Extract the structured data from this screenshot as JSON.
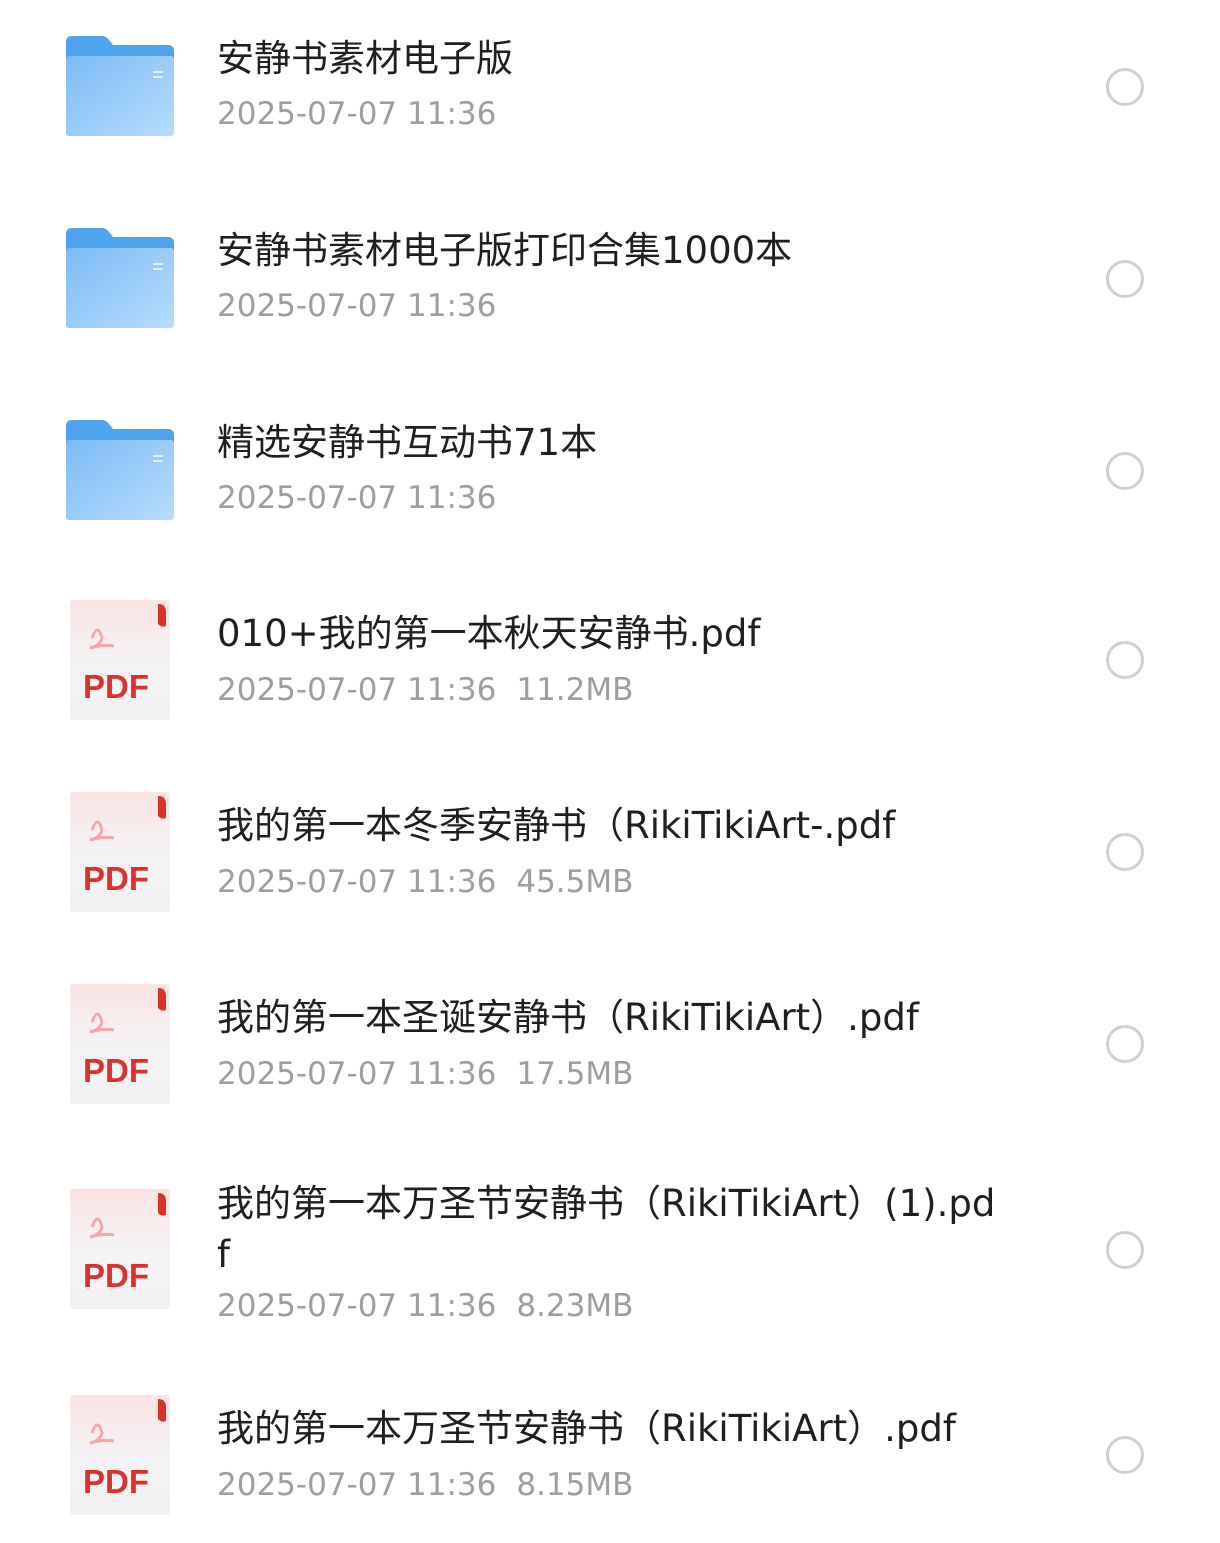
{
  "files": [
    {
      "type": "folder",
      "icon": "folder-icon",
      "name": "安静书素材电子版",
      "date": "2025-07-07 11:36",
      "size": ""
    },
    {
      "type": "folder",
      "icon": "folder-icon",
      "name": "安静书素材电子版打印合集1000本",
      "date": "2025-07-07 11:36",
      "size": ""
    },
    {
      "type": "folder",
      "icon": "folder-icon",
      "name": "精选安静书互动书71本",
      "date": "2025-07-07 11:36",
      "size": ""
    },
    {
      "type": "pdf",
      "icon": "pdf-file-icon",
      "icon_label": "PDF",
      "name": "010+我的第一本秋天安静书.pdf",
      "date": "2025-07-07 11:36",
      "size": "11.2MB"
    },
    {
      "type": "pdf",
      "icon": "pdf-file-icon",
      "icon_label": "PDF",
      "name": "我的第一本冬季安静书（RikiTikiArt-.pdf",
      "date": "2025-07-07 11:36",
      "size": "45.5MB"
    },
    {
      "type": "pdf",
      "icon": "pdf-file-icon",
      "icon_label": "PDF",
      "name": "我的第一本圣诞安静书（RikiTikiArt）.pdf",
      "date": "2025-07-07 11:36",
      "size": "17.5MB"
    },
    {
      "type": "pdf",
      "icon": "pdf-file-icon",
      "icon_label": "PDF",
      "name": "我的第一本万圣节安静书（RikiTikiArt）(1).pdf",
      "date": "2025-07-07 11:36",
      "size": "8.23MB"
    },
    {
      "type": "pdf",
      "icon": "pdf-file-icon",
      "icon_label": "PDF",
      "name": "我的第一本万圣节安静书（RikiTikiArt）.pdf",
      "date": "2025-07-07 11:36",
      "size": "8.15MB"
    }
  ],
  "colors": {
    "folder_back": "#4ea3ee",
    "folder_front": "#8cc8f8",
    "pdf_red": "#d9322c",
    "pdf_page": "#f3f3f5",
    "title_text": "#1f1f1f",
    "meta_text": "#9e9e9e",
    "radio_border": "#cfcfcf"
  }
}
